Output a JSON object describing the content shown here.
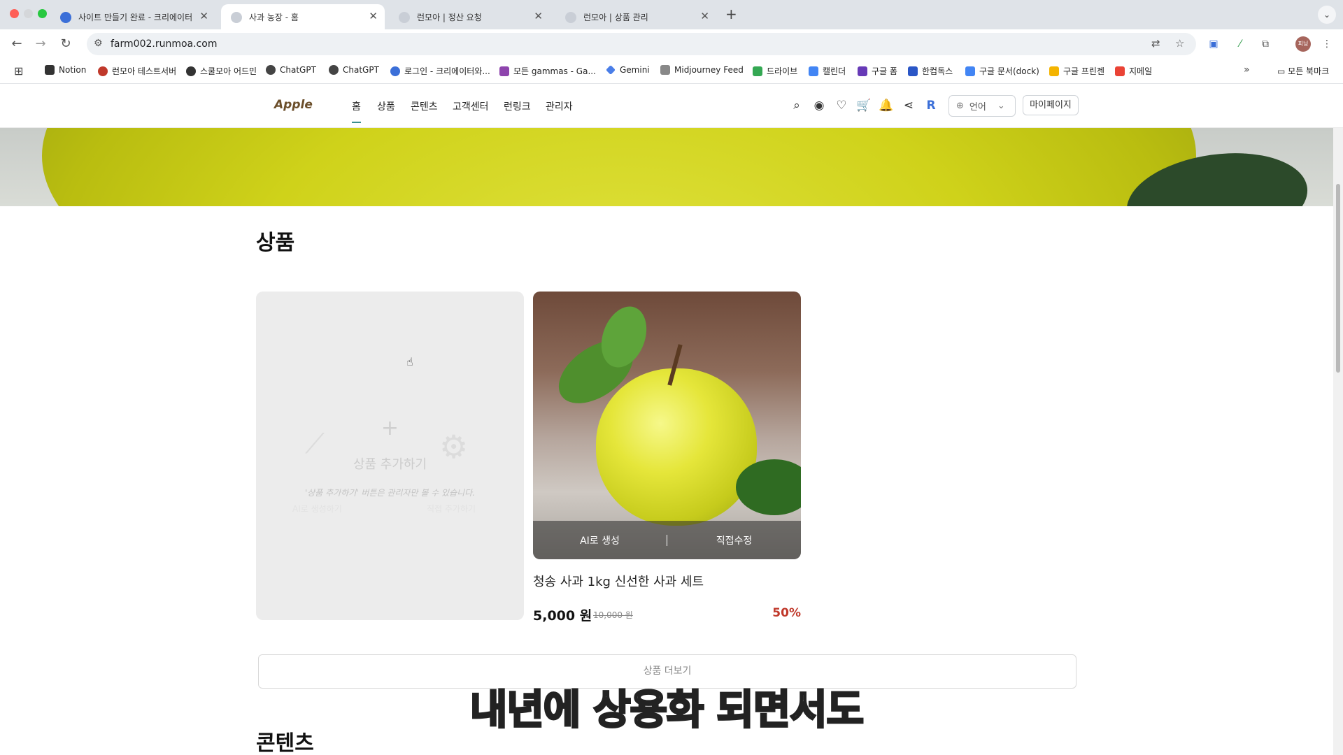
{
  "browser": {
    "tabs": [
      {
        "title": "사이트 만들기 완료 - 크리에이터의",
        "active": false
      },
      {
        "title": "사과 농장 - 홈",
        "active": true
      },
      {
        "title": "런모아 | 정산 요청",
        "active": false
      },
      {
        "title": "런모아 | 상품 관리",
        "active": false
      }
    ],
    "url": "farm002.runmoa.com",
    "bookmarks": [
      "Notion",
      "런모아 테스트서버",
      "스쿨모아 어드민",
      "ChatGPT",
      "ChatGPT",
      "로그인 - 크리에이터와...",
      "모든 gammas - Ga...",
      "Gemini",
      "Midjourney Feed",
      "드라이브",
      "캘린더",
      "구글 폼",
      "한컴독스",
      "구글 문서(dock)",
      "구글 프린젠",
      "지메일"
    ],
    "all_bookmarks": "모든 북마크",
    "profile_label": "피닝"
  },
  "site": {
    "logo": "Apple",
    "nav": [
      "홈",
      "상품",
      "콘텐츠",
      "고객센터",
      "런링크",
      "관리자"
    ],
    "language_label": "언어",
    "mypage_label": "마이페이지"
  },
  "products_section": {
    "title": "상품",
    "add_card": {
      "plus": "+",
      "label": "상품 추가하기",
      "note": "'상품 추가하기' 버튼은 관리자만 볼 수 있습니다.",
      "ghost_left": "AI로 생성하기",
      "ghost_right": "직접 추가하기"
    },
    "product": {
      "name": "청송 사과 1kg 신선한 사과 세트",
      "price": "5,000 원",
      "original_price": "10,000 원",
      "discount": "50%",
      "overlay_ai": "AI로 생성",
      "overlay_edit": "직접수정"
    },
    "more_label": "상품 더보기"
  },
  "contents_section": {
    "title": "콘텐츠"
  },
  "video_subtitle": "내년에 상용화 되면서도"
}
